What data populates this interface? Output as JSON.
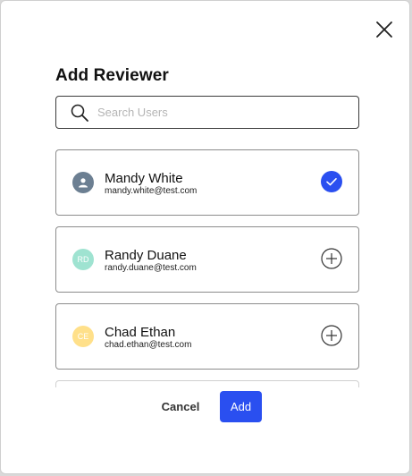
{
  "dialog": {
    "title": "Add Reviewer",
    "close_icon": "close-icon"
  },
  "search": {
    "placeholder": "Search Users",
    "value": "",
    "icon": "search-icon"
  },
  "users": [
    {
      "name": "Mandy White",
      "email": "mandy.white@test.com",
      "initials": "",
      "avatar_icon": "person-icon",
      "avatar_color": "#6c7f92",
      "selected": true,
      "action_icon": "check-circle-icon"
    },
    {
      "name": "Randy Duane",
      "email": "randy.duane@test.com",
      "initials": "RD",
      "avatar_color": "#9fe3d1",
      "selected": false,
      "action_icon": "plus-circle-icon"
    },
    {
      "name": "Chad Ethan",
      "email": "chad.ethan@test.com",
      "initials": "CE",
      "avatar_color": "#ffe08a",
      "selected": false,
      "action_icon": "plus-circle-icon"
    }
  ],
  "footer": {
    "cancel_label": "Cancel",
    "add_label": "Add"
  },
  "colors": {
    "accent": "#2a4ff0",
    "card_border": "#8c8c8c"
  }
}
